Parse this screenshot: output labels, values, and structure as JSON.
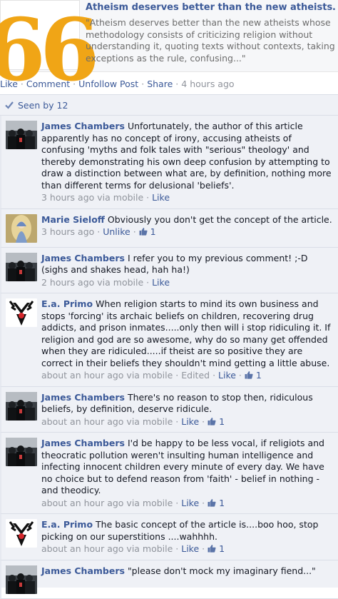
{
  "card": {
    "title": "Atheism deserves better than the new atheists…",
    "description": "\"Atheism deserves better than the new atheists whose methodology consists of criticizing religion without understanding it, quoting texts without contexts, taking exceptions as the rule, confusing...\"",
    "quote_glyph": "66",
    "accent_color": "#f0a516"
  },
  "actions": {
    "like": "Like",
    "comment": "Comment",
    "unfollow": "Unfollow Post",
    "share": "Share",
    "time": "4 hours ago"
  },
  "seen": "Seen by 12",
  "comments": [
    {
      "name": "James Chambers",
      "avatar": "dark-crowd",
      "text": "Unfortunately, the author of this article apparently has no concept of irony, accusing atheists of confusing 'myths and folk tales with \"serious\" theology' and thereby demonstrating his own deep confusion by attempting to draw a distinction between what are, by definition, nothing more than different terms for delusional 'beliefs'.",
      "time": "3 hours ago via mobile",
      "action": "Like",
      "edited": "",
      "likes": ""
    },
    {
      "name": "Marie Sieloff",
      "avatar": "mary-statue",
      "text": "Obviously you don't get the concept of the article.",
      "time": "3 hours ago",
      "action": "Unlike",
      "edited": "",
      "likes": "1"
    },
    {
      "name": "James Chambers",
      "avatar": "dark-crowd",
      "text": "I refer you to my previous comment! ;-D (sighs and shakes head, hah ha!)",
      "time": "2 hours ago via mobile",
      "action": "Like",
      "edited": "",
      "likes": ""
    },
    {
      "name": "E.a. Primo",
      "avatar": "stag-emblem",
      "text": "When religion starts to mind its own business and stops 'forcing' its archaic beliefs on children, recovering drug addicts, and prison inmates.....only then will i stop ridiculing it. If religion and god are so awesome, why do so many get offended when they are ridiculed.....if theist are so positive they are correct in their beliefs they shouldn't mind getting a little abuse.",
      "time": "about an hour ago via mobile",
      "action": "Like",
      "edited": "Edited",
      "likes": "1"
    },
    {
      "name": "James Chambers",
      "avatar": "dark-crowd",
      "text": "There's no reason to stop then, ridiculous beliefs, by definition, deserve ridicule.",
      "time": "about an hour ago via mobile",
      "action": "Like",
      "edited": "",
      "likes": "1"
    },
    {
      "name": "James Chambers",
      "avatar": "dark-crowd",
      "text": "I'd be happy to be less vocal, if religiots and theocratic pollution weren't insulting human intelligence and infecting innocent children every minute of every day. We have no choice but to defend reason from 'faith' - belief in nothing - and theodicy.",
      "time": "about an hour ago via mobile",
      "action": "Like",
      "edited": "",
      "likes": "1"
    },
    {
      "name": "E.a. Primo",
      "avatar": "stag-emblem",
      "text": "The basic concept of the article is....boo hoo, stop picking on our superstitions ....wahhhh.",
      "time": "about an hour ago via mobile",
      "action": "Like",
      "edited": "",
      "likes": "1"
    },
    {
      "name": "James Chambers",
      "avatar": "dark-crowd",
      "text": "\"please don't mock my imaginary fiend...\"",
      "time": "",
      "action": "",
      "edited": "",
      "likes": ""
    }
  ]
}
